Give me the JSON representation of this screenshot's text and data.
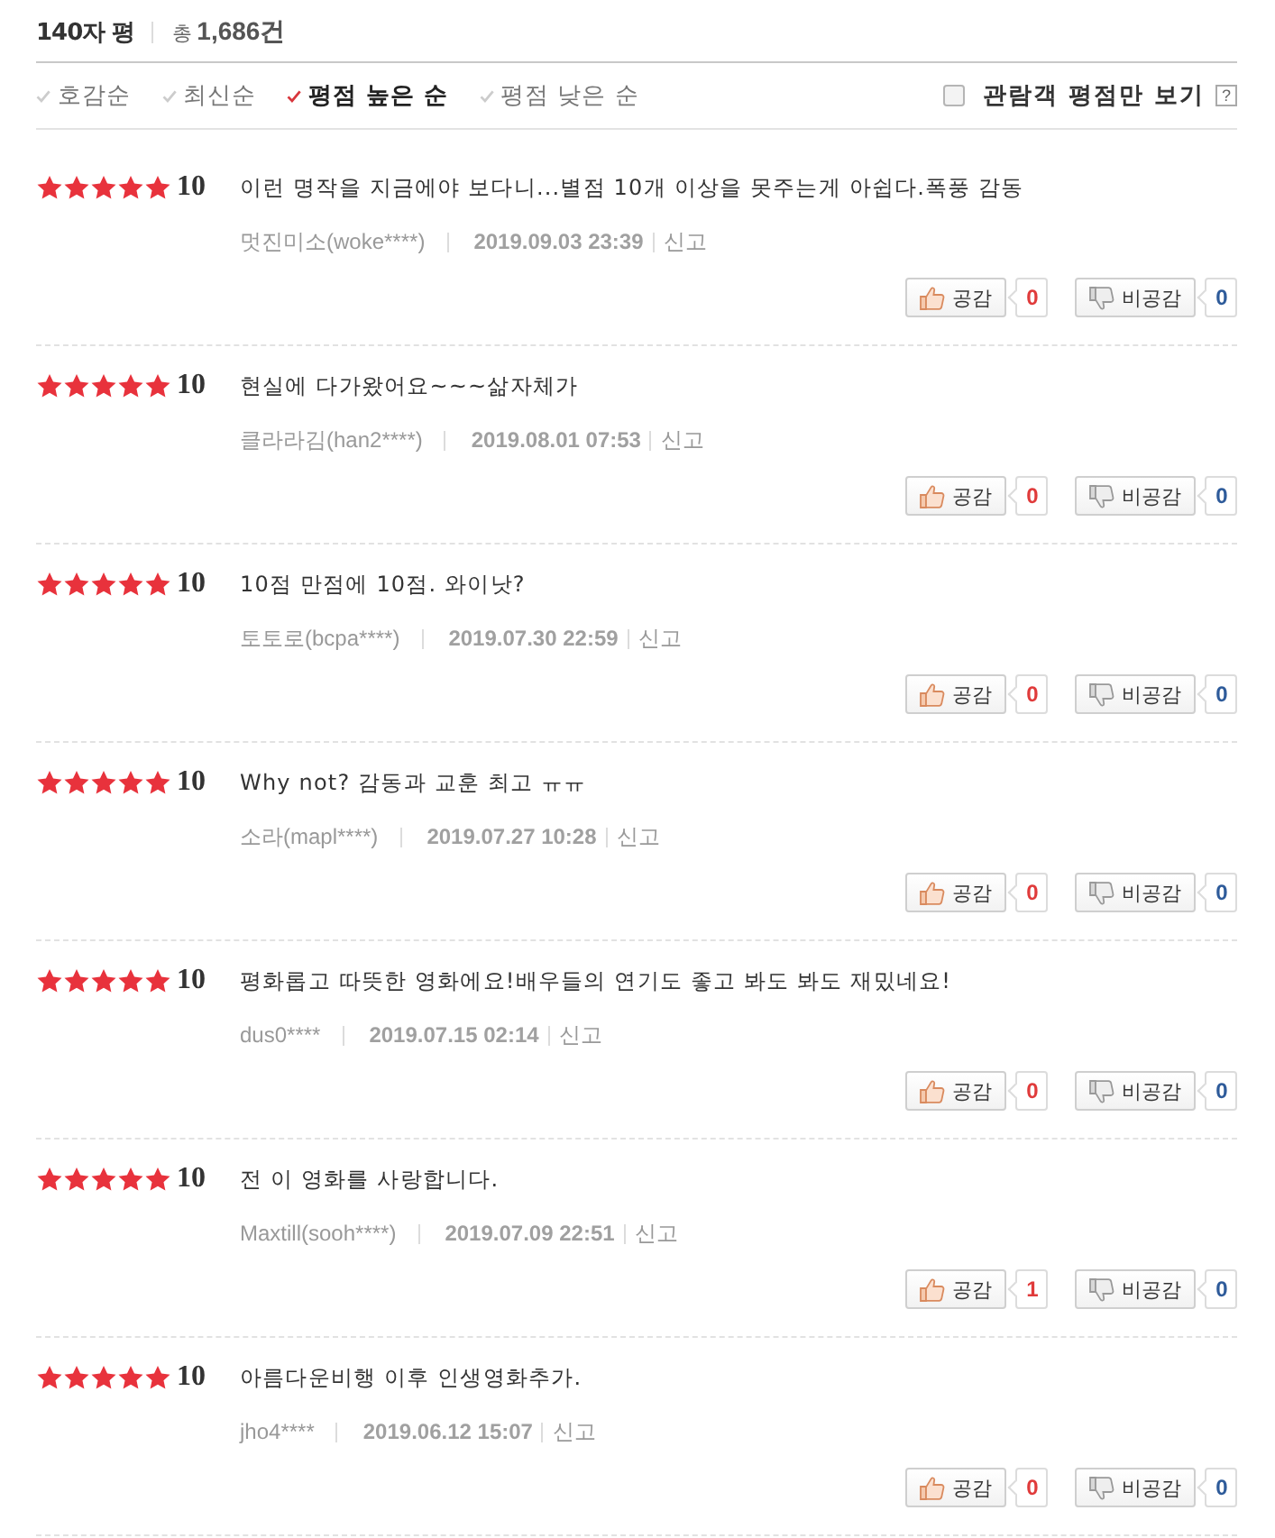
{
  "header": {
    "title": "140자 평",
    "total": "총 **1,686건**"
  },
  "sort_options": [
    {
      "label": "호감순",
      "selected": false
    },
    {
      "label": "최신순",
      "selected": false
    },
    {
      "label": "평점 높은 순",
      "selected": true
    },
    {
      "label": "평점 낮은 순",
      "selected": false
    }
  ],
  "filter": {
    "label": "관람객 평점만 보기",
    "checked": false,
    "help": "?"
  },
  "reviews": [
    {
      "stars": 5,
      "score": "10",
      "text": "이런 명작을 지금에야 보다니...별점 10개 이상을 못주는게 아쉽다.폭풍 감동",
      "author": "멋진미소(woke****)",
      "date": "2019.09.03 23:39",
      "report": "신고",
      "reactions": [
        {
          "kind": "like",
          "label": "공감",
          "count": "0"
        },
        {
          "kind": "dislike",
          "label": "비공감",
          "count": "0"
        }
      ]
    },
    {
      "stars": 5,
      "score": "10",
      "text": "현실에 다가왔어요~~~삶자체가",
      "author": "클라라김(han2****)",
      "date": "2019.08.01 07:53",
      "report": "신고",
      "reactions": [
        {
          "kind": "like",
          "label": "공감",
          "count": "0"
        },
        {
          "kind": "dislike",
          "label": "비공감",
          "count": "0"
        }
      ]
    },
    {
      "stars": 5,
      "score": "10",
      "text": "10점 만점에 10점. 와이낫?",
      "author": "토토로(bcpa****)",
      "date": "2019.07.30 22:59",
      "report": "신고",
      "reactions": [
        {
          "kind": "like",
          "label": "공감",
          "count": "0"
        },
        {
          "kind": "dislike",
          "label": "비공감",
          "count": "0"
        }
      ]
    },
    {
      "stars": 5,
      "score": "10",
      "text": "Why not? 감동과 교훈 최고 ㅠㅠ",
      "author": "소라(mapl****)",
      "date": "2019.07.27 10:28",
      "report": "신고",
      "reactions": [
        {
          "kind": "like",
          "label": "공감",
          "count": "0"
        },
        {
          "kind": "dislike",
          "label": "비공감",
          "count": "0"
        }
      ]
    },
    {
      "stars": 5,
      "score": "10",
      "text": "평화롭고 따뜻한 영화에요!배우들의 연기도 좋고 봐도 봐도 재밌네요!",
      "author": "dus0****",
      "date": "2019.07.15 02:14",
      "report": "신고",
      "reactions": [
        {
          "kind": "like",
          "label": "공감",
          "count": "0"
        },
        {
          "kind": "dislike",
          "label": "비공감",
          "count": "0"
        }
      ]
    },
    {
      "stars": 5,
      "score": "10",
      "text": "전 이 영화를 사랑합니다.",
      "author": "Maxtill(sooh****)",
      "date": "2019.07.09 22:51",
      "report": "신고",
      "reactions": [
        {
          "kind": "like",
          "label": "공감",
          "count": "1"
        },
        {
          "kind": "dislike",
          "label": "비공감",
          "count": "0"
        }
      ]
    },
    {
      "stars": 5,
      "score": "10",
      "text": "아름다운비행 이후 인생영화추가.",
      "author": "jho4****",
      "date": "2019.06.12 15:07",
      "report": "신고",
      "reactions": [
        {
          "kind": "like",
          "label": "공감",
          "count": "0"
        },
        {
          "kind": "dislike",
          "label": "비공감",
          "count": "0"
        }
      ]
    }
  ]
}
